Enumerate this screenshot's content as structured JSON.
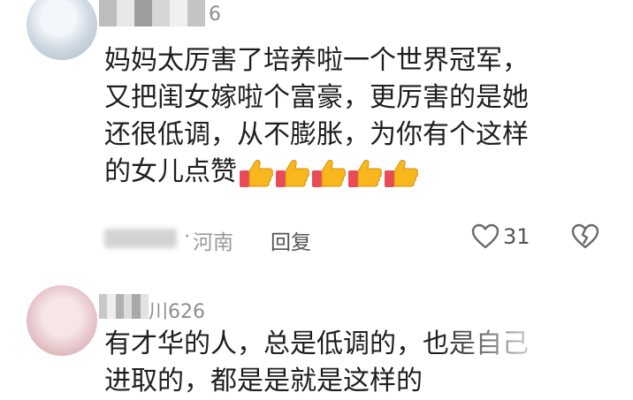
{
  "comments": [
    {
      "username": "6",
      "text_lines": [
        "妈妈太厉害了培养啦一个世界冠军，",
        "又把闺女嫁啦个富豪，更厉害的是她",
        "还很低调，从不膨胀，为你有个这样",
        "的女儿点赞"
      ],
      "emoji": {
        "name": "thumbs-up-icon",
        "count": 5
      },
      "date": "",
      "location": "河南",
      "reply_label": "回复",
      "likes": "31"
    },
    {
      "username": "川626",
      "text_lines": [
        "有才华的人，总是低调的，也是自己",
        "进取的，都是是就是这样的"
      ]
    }
  ],
  "colors": {
    "text": "#1e1e1e",
    "meta": "#9a9a9a",
    "thumb_yellow": "#f7b71d",
    "thumb_cuff": "#e94b59"
  }
}
